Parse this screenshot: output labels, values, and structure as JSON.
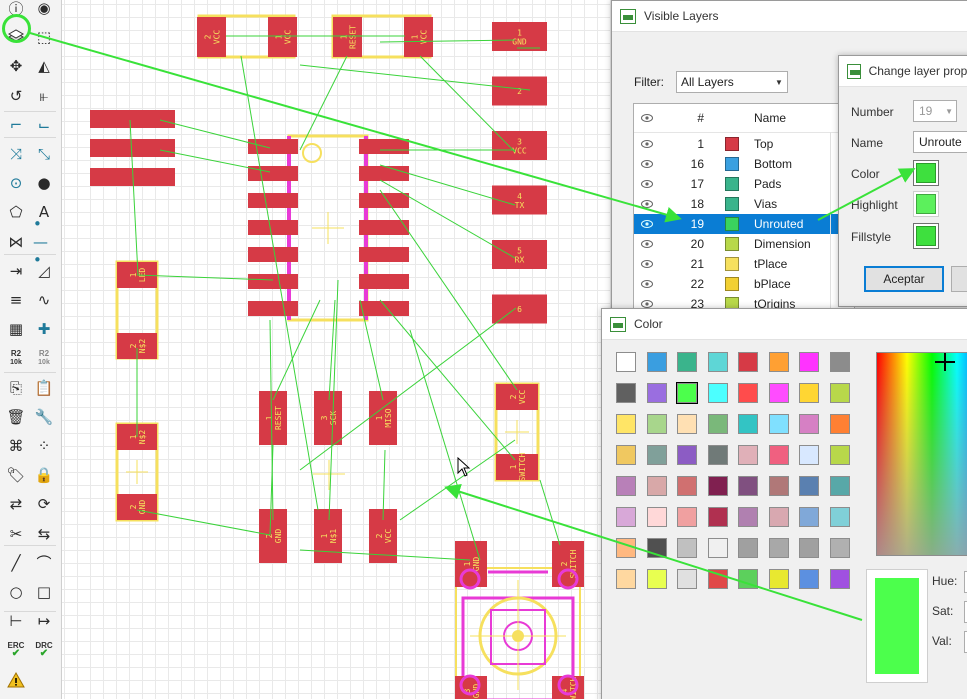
{
  "colors": {
    "pad": "#d63a46",
    "silk": "#f6e05e",
    "airwire": "#3ad33a",
    "bottom_trace": "#e83ad6",
    "annotation": "#39e239",
    "selection": "#0a7dd4"
  },
  "toolbar": {
    "icons": [
      "info-icon",
      "eye-icon",
      "layers-icon",
      "select-icon",
      "move-icon",
      "mirror-icon",
      "rotate-icon",
      "align-icon",
      "route-icon",
      "ripup-icon",
      "swap-icon",
      "split-icon",
      "add-via-icon",
      "hole-icon",
      "polygon-icon",
      "text-icon",
      "signal-icon",
      "wire-icon",
      "meander-icon",
      "miter-icon",
      "bus-icon",
      "wave-icon",
      "package-icon",
      "add-part-icon",
      "name-icon",
      "value-icon",
      "copy-icon",
      "paste-icon",
      "delete-icon",
      "wrench-icon",
      "smash-icon",
      "group-icon",
      "tag-icon",
      "lock-icon",
      "replace-icon",
      "optimize-icon",
      "cut-icon",
      "dash-icon",
      "line-icon",
      "arc-icon",
      "circle-icon",
      "rect-icon",
      "dim-icon",
      "measure-icon",
      "erc-icon",
      "drc-icon",
      "warning-icon"
    ],
    "name_label": "R2",
    "name_sub": "10k",
    "value_label": "R2",
    "value_sub": "10k",
    "erc_label": "ERC",
    "drc_label": "DRC"
  },
  "board": {
    "top_parts": [
      {
        "pads": [
          "2\nVCC",
          "1\nVCC"
        ]
      },
      {
        "pads": [
          "1\nRESET",
          "1\nVCC"
        ]
      }
    ],
    "header_pads": [
      "1\nGND",
      "2",
      "3\nVCC",
      "4\nTX",
      "5\nRX",
      "6"
    ],
    "led_pads": [
      "1\nLED",
      "2\nN$2"
    ],
    "r_pads": [
      "1\nN$2",
      "2\nGND"
    ],
    "icsp_top": [
      "1\nRESET",
      "3\nSCK",
      "1\nMISO"
    ],
    "icsp_bottom": [
      "2\nGND",
      "1\nN$1",
      "2\nVCC"
    ],
    "switch_pads": [
      "2\nVCC",
      "1\nSWITCH"
    ],
    "button_pads": [
      "1\nGND",
      "2\nSWITCH",
      "3\nGND",
      "4\nSWITCH"
    ]
  },
  "visible_layers": {
    "title": "Visible Layers",
    "filter_label": "Filter:",
    "filter_value": "All Layers",
    "col_num": "#",
    "col_name": "Name",
    "rows": [
      {
        "num": "1",
        "name": "Top",
        "color": "#d63a46"
      },
      {
        "num": "16",
        "name": "Bottom",
        "color": "#3aa0e0"
      },
      {
        "num": "17",
        "name": "Pads",
        "color": "#3ab48c"
      },
      {
        "num": "18",
        "name": "Vias",
        "color": "#3ab48c"
      },
      {
        "num": "19",
        "name": "Unrouted",
        "color": "#3ad35e",
        "selected": true
      },
      {
        "num": "20",
        "name": "Dimension",
        "color": "#b8d84a"
      },
      {
        "num": "21",
        "name": "tPlace",
        "color": "#f6e05e"
      },
      {
        "num": "22",
        "name": "bPlace",
        "color": "#f2d033"
      },
      {
        "num": "23",
        "name": "tOrigins",
        "color": "#b8d84a"
      }
    ]
  },
  "change_layer": {
    "title": "Change layer prope",
    "number_label": "Number",
    "number_value": "19",
    "name_label": "Name",
    "name_value": "Unroute",
    "color_label": "Color",
    "highlight_label": "Highlight",
    "fillstyle_label": "Fillstyle",
    "color_value": "#3ee03e",
    "highlight_value": "#5cf05c",
    "fillstyle_value": "#3ee03e",
    "ok_label": "Aceptar"
  },
  "color_dialog": {
    "title": "Color",
    "hue_label": "Hue:",
    "sat_label": "Sat:",
    "val_label": "Val:",
    "preview_color": "#4cff4c",
    "palette": [
      "#ffffff",
      "#3a9ee0",
      "#3ab48c",
      "#5ed6d6",
      "#d63a46",
      "#ffa033",
      "#ff33ff",
      "#8c8c8c",
      "#606060",
      "#9a6ee0",
      "#4cff4c",
      "#4cffff",
      "#ff4c4c",
      "#ff4cff",
      "#ffd633",
      "#b8d84a",
      "#ffe566",
      "#a8d68c",
      "#ffe0b3",
      "#7ab87a",
      "#33c4c4",
      "#80e0ff",
      "#d680c4",
      "#ff8033",
      "#f0c860",
      "#80a09a",
      "#8c5cc4",
      "#707a78",
      "#e0b0b8",
      "#f06080",
      "#d8e8ff",
      "#b8d84a",
      "#b880b8",
      "#d8a8a8",
      "#d07070",
      "#802050",
      "#805080",
      "#b07878",
      "#5a80b0",
      "#58a8a8",
      "#d8a8d8",
      "#ffd8d8",
      "#f0a0a0",
      "#b03050",
      "#b080b0",
      "#d8a8b0",
      "#80a8d8",
      "#80d0d8",
      "#ffb880",
      "#505050",
      "#c0c0c0",
      "#f0f0f0",
      "#a0a0a0",
      "#a8a8a8",
      "#a0a0a0",
      "#b0b0b0",
      "#ffd8a0",
      "#e8ff50",
      "#e0e0e0",
      "#e04848",
      "#5cd05c",
      "#e8e830",
      "#5c90e0",
      "#a050e0"
    ]
  }
}
